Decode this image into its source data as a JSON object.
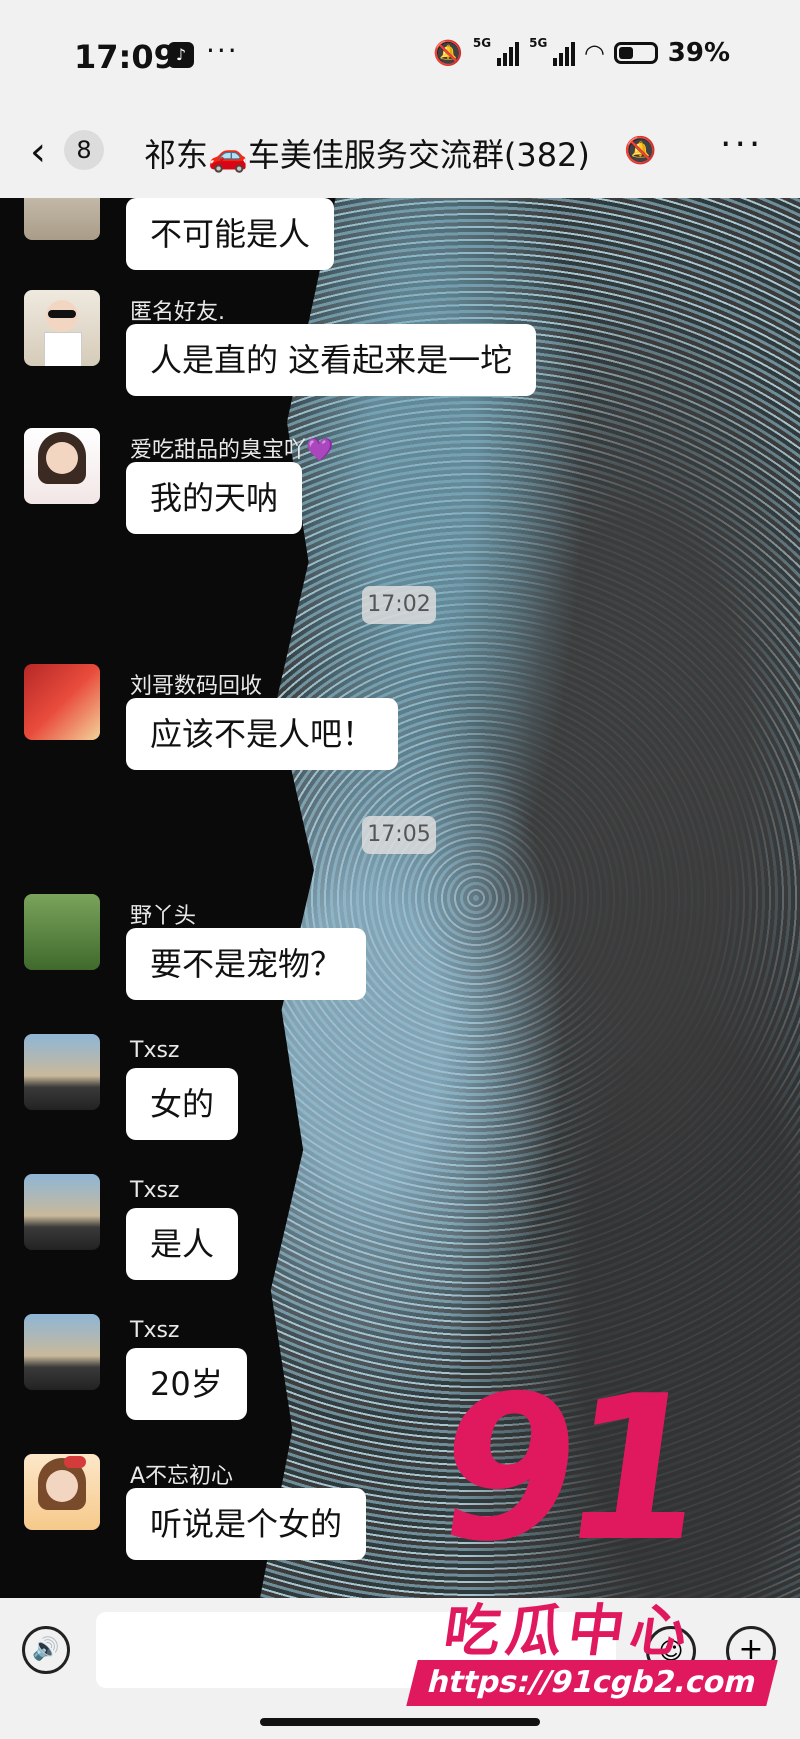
{
  "status_bar": {
    "time": "17:09",
    "tiktok_icon": "♪",
    "dots": "···",
    "net_1": "5G",
    "net_2": "5G",
    "battery_percent": "39%"
  },
  "header": {
    "back_icon": "‹",
    "unread_count": "8",
    "title": "祁东🚗车美佳服务交流群(382)",
    "bell_icon": "🔕",
    "more_icon": "···"
  },
  "messages": [
    {
      "name": "",
      "text": "不可能是人"
    },
    {
      "name": "匿名好友.",
      "text": "人是直的 这看起来是一坨"
    },
    {
      "name": "爱吃甜品的臭宝吖💜",
      "text": "我的天呐"
    },
    {
      "name": "刘哥数码回收",
      "text": "应该不是人吧！"
    },
    {
      "name": "野丫头",
      "text": "要不是宠物？"
    },
    {
      "name": "Txsz",
      "text": "女的"
    },
    {
      "name": "Txsz",
      "text": "是人"
    },
    {
      "name": "Txsz",
      "text": "20岁"
    },
    {
      "name": "A不忘初心",
      "text": "听说是个女的"
    }
  ],
  "timestamps": [
    "17:02",
    "17:05"
  ],
  "watermark": {
    "big": "91",
    "text": "吃瓜中心",
    "url": "https://91cgb2.com"
  },
  "input_bar": {
    "voice_icon": "🔊",
    "emoji_icon": "☺",
    "plus_icon": "+"
  }
}
